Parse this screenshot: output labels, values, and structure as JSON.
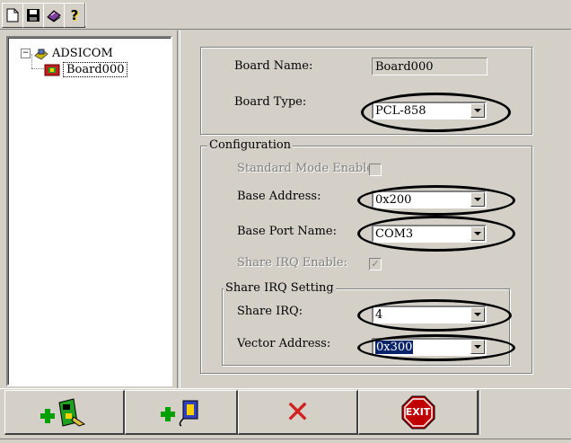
{
  "toolbar": {
    "buttons": [
      {
        "name": "new-file-icon"
      },
      {
        "name": "save-icon"
      },
      {
        "name": "book-icon"
      },
      {
        "name": "help-icon",
        "glyph": "?"
      }
    ]
  },
  "tree": {
    "expander": "−",
    "root_label": "ADSICOM",
    "child_label": "Board000"
  },
  "board": {
    "name_label": "Board Name:",
    "name_value": "Board000",
    "type_label": "Board Type:",
    "type_value": "PCL-858"
  },
  "configuration": {
    "group_label": "Configuration",
    "standard_mode_label": "Standard Mode Enable:",
    "base_address_label": "Base Address:",
    "base_address_value": "0x200",
    "base_port_label": "Base Port Name:",
    "base_port_value": "COM3",
    "share_irq_enable_label": "Share IRQ Enable:",
    "share_irq_enable_check": "✓"
  },
  "share_irq_setting": {
    "group_label": "Share IRQ Setting",
    "share_irq_label": "Share IRQ:",
    "share_irq_value": "4",
    "vector_address_label": "Vector Address:",
    "vector_address_value": "0x300"
  },
  "bottom_buttons": {
    "add_board_icon": "add-board-icon",
    "add_port_icon": "add-port-icon",
    "delete_glyph": "✕",
    "exit_label": "EXIT"
  },
  "colors": {
    "face": "#d4d0c8",
    "selection": "#0a246a",
    "delete_red": "#d21f1f",
    "stop_red": "#c00000",
    "plus_green": "#00a000"
  }
}
